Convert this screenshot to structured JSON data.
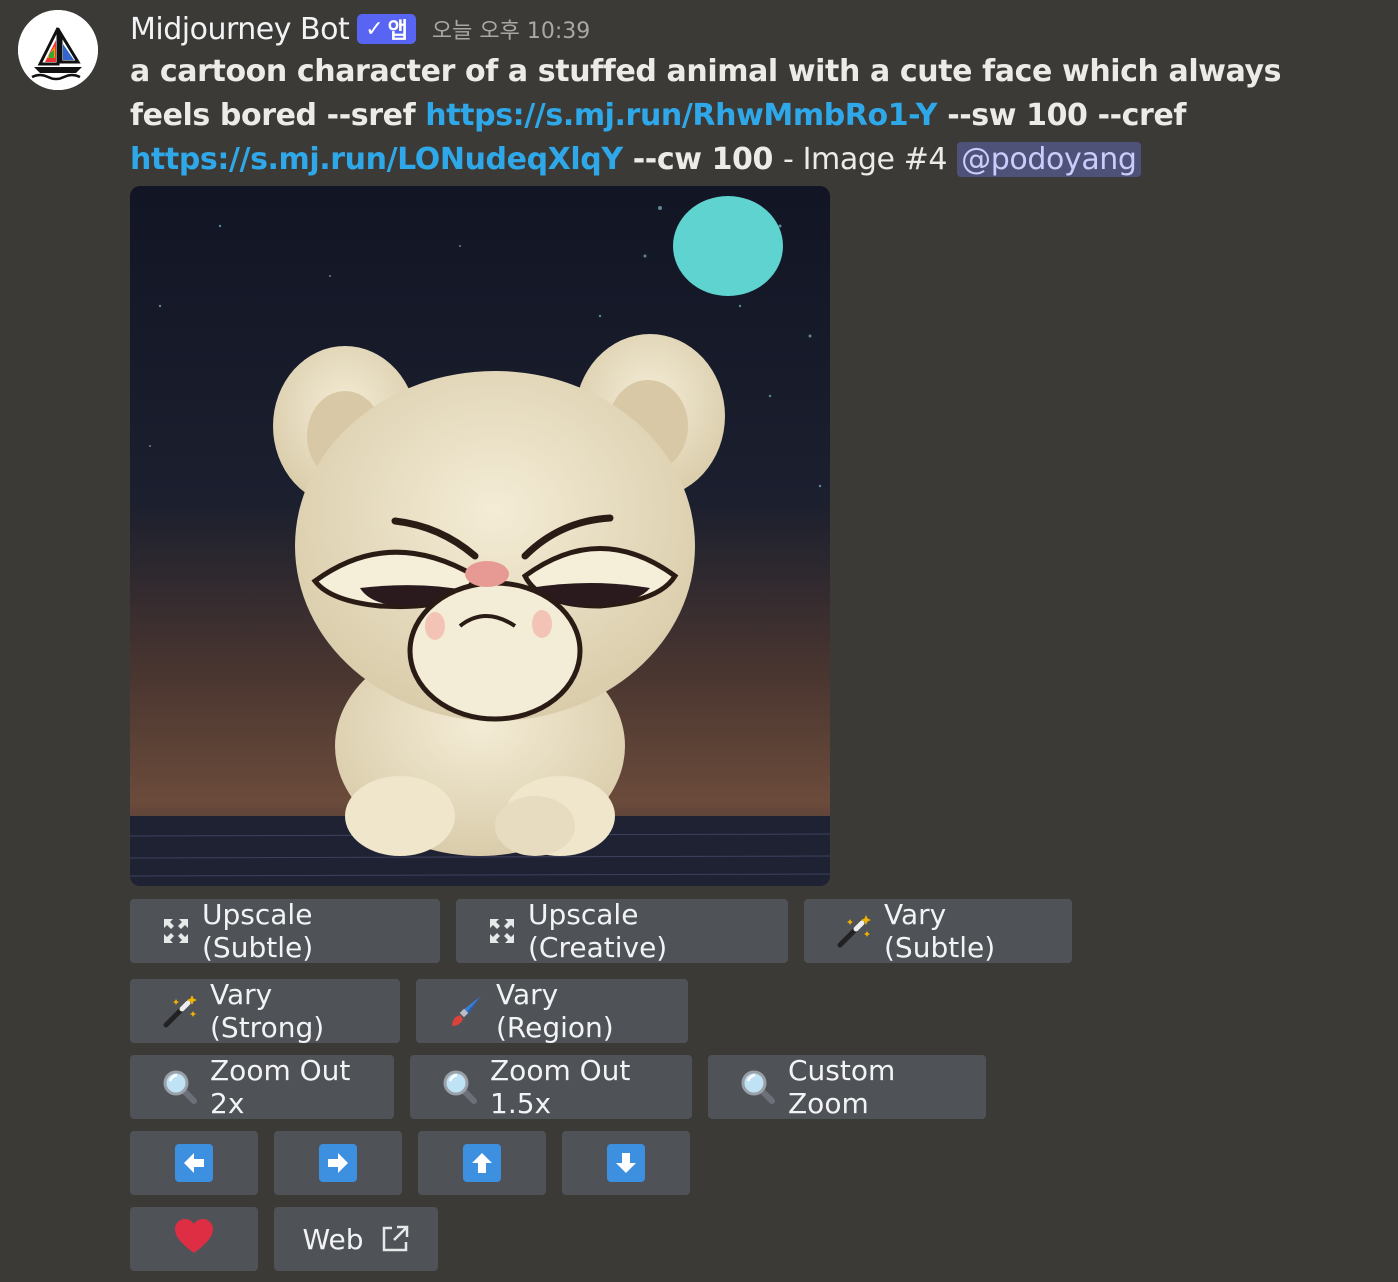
{
  "message": {
    "author": "Midjourney Bot",
    "badge": "앱",
    "timestamp": "오늘 오후 10:39",
    "prompt_prefix": "a cartoon character of a stuffed animal with a cute face which always feels bored --sref",
    "sref_link": "https://s.mj.run/RhwMmbRo1-Y",
    "sref_suffix": "--sw 100 --cref",
    "cref_link": "https://s.mj.run/LONudeqXlqY",
    "cref_suffix": "--cw 100",
    "image_label": "- Image #4",
    "mention": "@podoyang"
  },
  "image": {
    "subject": "grumpy fluffy cream bear cartoon under a night sky with a turquoise moon"
  },
  "buttons": {
    "upscale_subtle": "Upscale (Subtle)",
    "upscale_creative": "Upscale (Creative)",
    "vary_subtle": "Vary (Subtle)",
    "vary_strong": "Vary (Strong)",
    "vary_region": "Vary (Region)",
    "zoom_out_2x": "Zoom Out 2x",
    "zoom_out_1_5x": "Zoom Out 1.5x",
    "custom_zoom": "Custom Zoom",
    "web": "Web"
  },
  "icons": {
    "upscale": "expand-arrows-icon",
    "vary": "magic-wand-icon",
    "region": "paintbrush-icon",
    "zoom": "magnifier-icon",
    "pan_left": "arrow-left-icon",
    "pan_right": "arrow-right-icon",
    "pan_up": "arrow-up-icon",
    "pan_down": "arrow-down-icon",
    "favorite": "heart-icon",
    "external": "external-link-icon"
  },
  "colors": {
    "background": "#3b3a36",
    "button": "#4f5257",
    "link": "#2fa8ea",
    "badge": "#5865f2",
    "arrow": "#3d8fe0",
    "heart": "#dd2e44",
    "moon": "#5fd3cf"
  }
}
